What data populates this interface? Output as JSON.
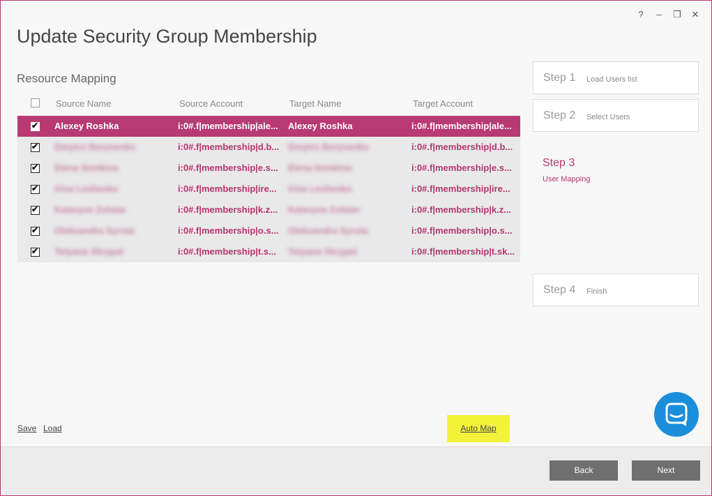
{
  "window": {
    "help_icon": "?",
    "minimize_icon": "–",
    "restore_icon": "❐",
    "close_icon": "✕"
  },
  "title": "Update Security Group Membership",
  "section_title": "Resource Mapping",
  "grid": {
    "columns": [
      "Source Name",
      "Source Account",
      "Target Name",
      "Target Account"
    ],
    "rows": [
      {
        "checked": true,
        "selected": true,
        "source_name": "Alexey Roshka",
        "source_account": "i:0#.f|membership|ale...",
        "target_name": "Alexey Roshka",
        "target_account": "i:0#.f|membership|ale..."
      },
      {
        "checked": true,
        "selected": false,
        "source_name": "Dmytro Borysenko",
        "source_account": "i:0#.f|membership|d.b...",
        "target_name": "Dmytro Borysenko",
        "target_account": "i:0#.f|membership|d.b..."
      },
      {
        "checked": true,
        "selected": false,
        "source_name": "Elena Semkina",
        "source_account": "i:0#.f|membership|e.s...",
        "target_name": "Elena Semkina",
        "target_account": "i:0#.f|membership|e.s..."
      },
      {
        "checked": true,
        "selected": false,
        "source_name": "Irina Leshenko",
        "source_account": "i:0#.f|membership|ire...",
        "target_name": "Irina Leshenko",
        "target_account": "i:0#.f|membership|ire..."
      },
      {
        "checked": true,
        "selected": false,
        "source_name": "Kateryna Zolotar",
        "source_account": "i:0#.f|membership|k.z...",
        "target_name": "Kateryna Zolotar",
        "target_account": "i:0#.f|membership|k.z..."
      },
      {
        "checked": true,
        "selected": false,
        "source_name": "Oleksandra Syrota",
        "source_account": "i:0#.f|membership|o.s...",
        "target_name": "Oleksandra Syrota",
        "target_account": "i:0#.f|membership|o.s..."
      },
      {
        "checked": true,
        "selected": false,
        "source_name": "Tetyana Skrypal",
        "source_account": "i:0#.f|membership|t.s...",
        "target_name": "Tetyana Skrypal",
        "target_account": "i:0#.f|membership|t.sk..."
      }
    ]
  },
  "steps": [
    {
      "num": "Step 1",
      "label": "Load Users list",
      "active": false
    },
    {
      "num": "Step 2",
      "label": "Select Users",
      "active": false
    },
    {
      "num": "Step 3",
      "label": "User Mapping",
      "active": true
    },
    {
      "num": "Step 4",
      "label": "Finish",
      "active": false
    }
  ],
  "actions": {
    "save": "Save",
    "load": "Load",
    "auto_map": "Auto Map"
  },
  "footer": {
    "back": "Back",
    "next": "Next"
  },
  "colors": {
    "accent": "#b5366f",
    "selected_row": "#b73a73",
    "highlight": "#f3f23a",
    "chat": "#1a8edb",
    "button": "#6f6f6f"
  }
}
